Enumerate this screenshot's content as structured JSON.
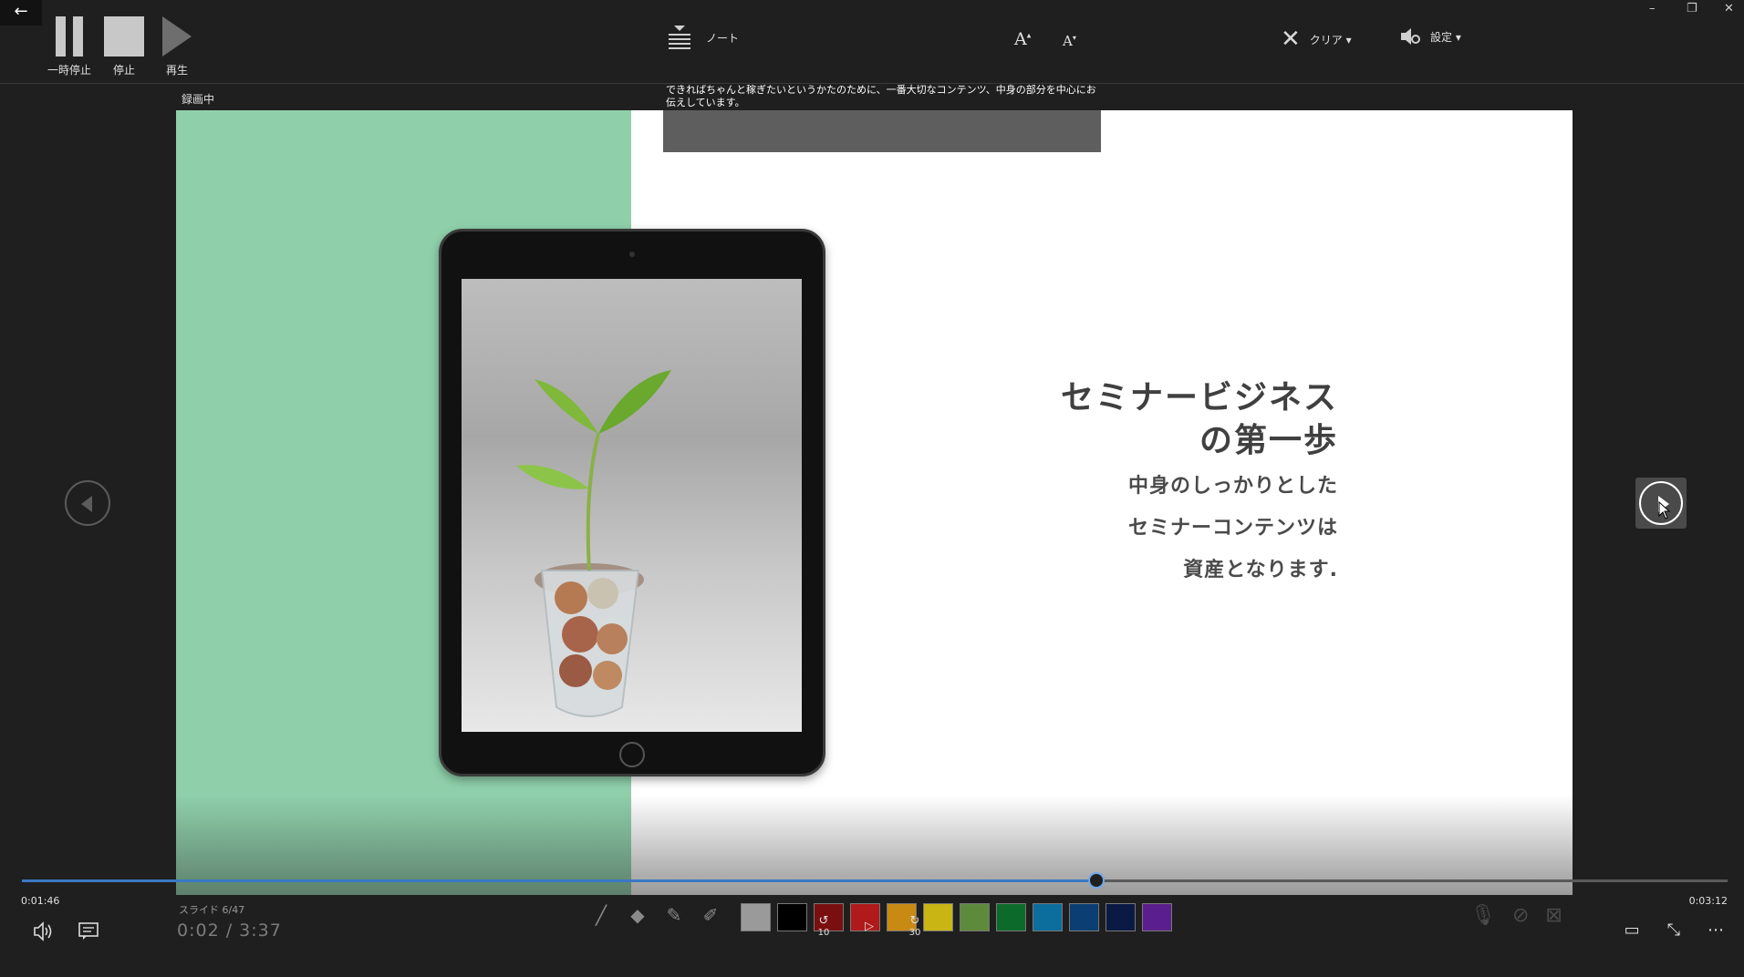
{
  "window": {
    "back_label": "←",
    "min_label": "–",
    "restore_label": "❐",
    "close_label": "✕"
  },
  "record_controls": {
    "pause_label": "一時停止",
    "stop_label": "停止",
    "play_label": "再生"
  },
  "toolbar": {
    "notes_label": "ノート",
    "font_up_label": "A",
    "font_down_label": "A",
    "clear_label": "クリア ▾",
    "settings_label": "設定 ▾"
  },
  "status": {
    "recording": "録画中"
  },
  "notes": {
    "text": "できればちゃんと稼ぎたいというかたのために、一番大切なコンテンツ、中身の部分を中心にお伝えしています。"
  },
  "slide": {
    "title_line1": "セミナービジネス",
    "title_line2": "の第一歩",
    "body_line1": "中身のしっかりとした",
    "body_line2": "セミナーコンテンツは",
    "body_line3": "資産となります."
  },
  "timeline": {
    "position_fraction": 0.63,
    "time_left": "0:01:46",
    "time_right": "0:03:12",
    "slide_counter": "スライド 6/47",
    "elapsed": "0:02 / 3:37"
  },
  "playback": {
    "rewind_label": "10",
    "forward_label": "30"
  },
  "pen_colors": [
    "#9a9a9a",
    "#000000",
    "#7a0f10",
    "#b01a1a",
    "#c88a12",
    "#c9b514",
    "#5e8a3c",
    "#0c6b2a",
    "#0b6e9c",
    "#0b3f73",
    "#0a1a44",
    "#5a1f8c"
  ],
  "colors": {
    "slide_accent": "#8fd0ab",
    "progress": "#3b78c4"
  }
}
